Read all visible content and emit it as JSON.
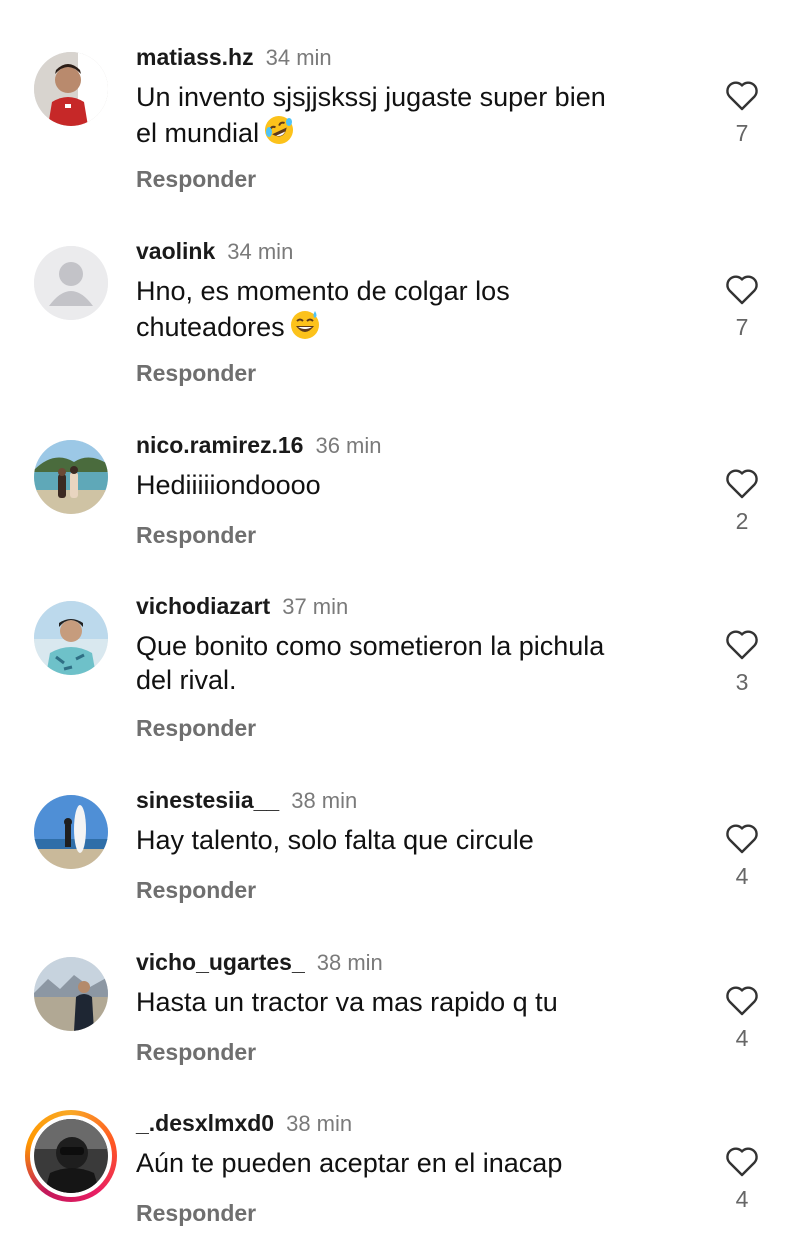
{
  "comments": [
    {
      "username": "matiass.hz",
      "time": "34 min",
      "line1": "Un invento sjsjjskssj jugaste super bien",
      "line2": "el mundial",
      "emoji": "rolling-laughing",
      "reply": "Responder",
      "likes": "7",
      "avatar": "photo-man-red"
    },
    {
      "username": "vaolink",
      "time": "34 min",
      "line1": "Hno, es momento de colgar los",
      "line2": "chuteadores",
      "emoji": "sweat-smile",
      "reply": "Responder",
      "likes": "7",
      "avatar": "default-user"
    },
    {
      "username": "nico.ramirez.16",
      "time": "36 min",
      "line1": "Hediiiiiondoooo",
      "line2": "",
      "emoji": "",
      "reply": "Responder",
      "likes": "2",
      "avatar": "photo-beach-couple"
    },
    {
      "username": "vichodiazart",
      "time": "37 min",
      "line1": "Que bonito como sometieron la pichula",
      "line2": "del rival.",
      "emoji": "",
      "reply": "Responder",
      "likes": "3",
      "avatar": "photo-man-cap"
    },
    {
      "username": "sinestesiia__",
      "time": "38 min",
      "line1": "Hay talento, solo falta que circule",
      "line2": "",
      "emoji": "",
      "reply": "Responder",
      "likes": "4",
      "avatar": "photo-surfboard"
    },
    {
      "username": "vicho_ugartes_",
      "time": "38 min",
      "line1": "Hasta un tractor va mas rapido q tu",
      "line2": "",
      "emoji": "",
      "reply": "Responder",
      "likes": "4",
      "avatar": "photo-mountain"
    },
    {
      "username": "_.desxlmxd0",
      "time": "38 min",
      "line1": "Aún te pueden aceptar en el inacap",
      "line2": "",
      "emoji": "",
      "reply": "Responder",
      "likes": "4",
      "avatar": "photo-dark-story"
    }
  ],
  "icons": {
    "like": "heart-outline-icon"
  },
  "colors": {
    "username": "#1a1a1a",
    "meta": "#7a7a7a",
    "reply": "#6f6f6f",
    "story_ring": "#e91e63"
  }
}
